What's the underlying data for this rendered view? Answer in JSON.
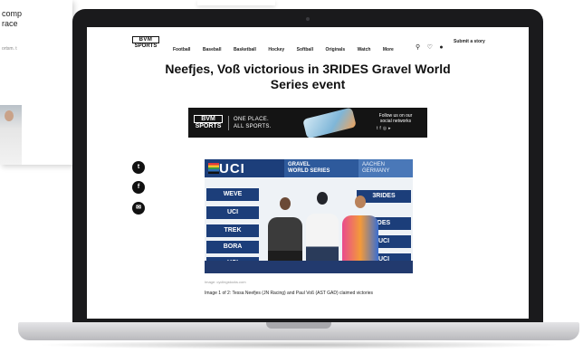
{
  "background_page": {
    "teaser_line1": "comp",
    "teaser_line2": "race",
    "teaser_meta": "ortsm. t"
  },
  "site": {
    "logo_top": "BVM",
    "logo_bottom": "SPORTS",
    "nav": [
      "Football",
      "Baseball",
      "Basketball",
      "Hockey",
      "Softball",
      "Originals",
      "Watch",
      "More"
    ],
    "submit_story": "Submit a story"
  },
  "article": {
    "headline": "Neefjes, Voß victorious in 3RIDES Gravel World Series event",
    "image_credit": "Image: cyclingstocks.com",
    "caption": "Image 1 of 2: Tessa Neefjes (JN Racing) and Paul Voß (AST GAD) claimed victories"
  },
  "ad": {
    "logo_top": "BVM",
    "logo_bottom": "SPORTS",
    "slogan_line1": "ONE PLACE.",
    "slogan_line2": "ALL SPORTS.",
    "follow_line1": "Follow us on our",
    "follow_line2": "social networks"
  },
  "photo": {
    "banner_left": "UCI",
    "banner_mid_line1": "GRAVEL",
    "banner_mid_line2": "WORLD SERIES",
    "banner_right_line1": "AACHEN",
    "banner_right_line2": "GERMANY",
    "boards_left": [
      "WEVE",
      "UCI",
      "TREK",
      "BORA",
      "UCI"
    ],
    "boards_right": [
      "3RIDES",
      "DES",
      "UCI",
      "UCI"
    ]
  },
  "icons": {
    "share": [
      "twitter-icon",
      "facebook-icon",
      "email-icon"
    ],
    "header": [
      "search-icon",
      "heart-icon",
      "user-icon"
    ]
  },
  "colors": {
    "uci_blue": "#1c3e7a",
    "ad_background": "#141414",
    "share_button": "#111111"
  }
}
